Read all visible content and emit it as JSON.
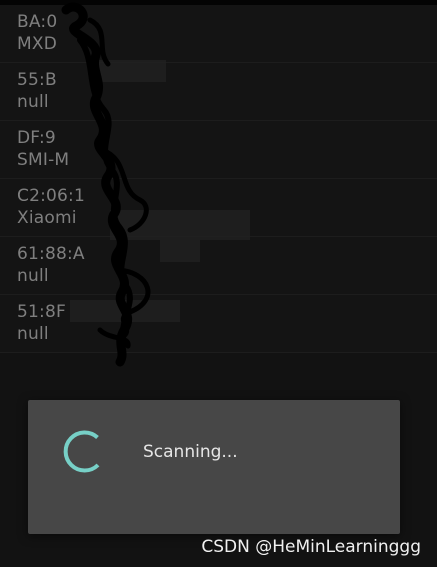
{
  "devices": [
    {
      "address": "BA:0",
      "name": "MXD"
    },
    {
      "address": "55:B",
      "name": "null"
    },
    {
      "address": "DF:9",
      "name": "SMI-M"
    },
    {
      "address": "C2:06:1",
      "name": "Xiaomi"
    },
    {
      "address": "61:88:A",
      "name": "null"
    },
    {
      "address": "51:8F",
      "name": "null"
    }
  ],
  "dialog": {
    "message": "Scanning..."
  },
  "watermark": "CSDN @HeMinLearninggg",
  "colors": {
    "spinner": "#77d0c7",
    "dialog_bg": "#474747",
    "background": "#181818"
  }
}
